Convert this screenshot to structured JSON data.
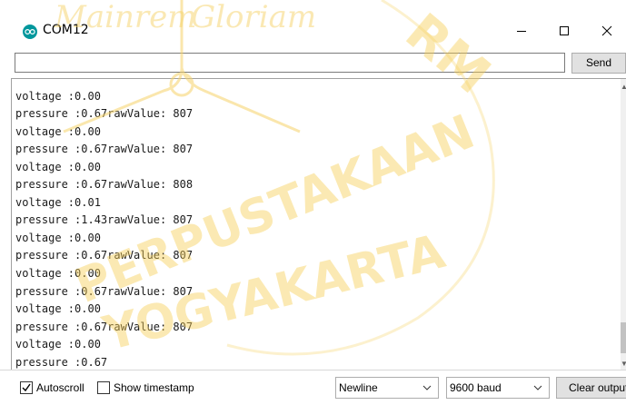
{
  "window": {
    "title": "COM12",
    "icon": "arduino-icon",
    "controls": [
      "minimize-icon",
      "maximize-icon",
      "close-icon"
    ]
  },
  "send_row": {
    "input_value": "",
    "send_label": "Send"
  },
  "output": {
    "lines": [
      "voltage :0.00",
      "pressure :0.67rawValue: 807",
      "voltage :0.00",
      "pressure :0.67rawValue: 807",
      "voltage :0.00",
      "pressure :0.67rawValue: 808",
      "voltage :0.01",
      "pressure :1.43rawValue: 807",
      "voltage :0.00",
      "pressure :0.67rawValue: 807",
      "voltage :0.00",
      "pressure :0.67rawValue: 807",
      "voltage :0.00",
      "pressure :0.67rawValue: 807",
      "voltage :0.00",
      "pressure :0.67"
    ]
  },
  "bottom_bar": {
    "autoscroll_label": "Autoscroll",
    "autoscroll_checked": true,
    "timestamp_label": "Show timestamp",
    "timestamp_checked": false,
    "line_ending": "Newline",
    "baud_rate": "9600 baud",
    "clear_label": "Clear output"
  },
  "watermark": {
    "text_top": "Mainrem Gloriam",
    "text_middle": "PERPUSTAKAAN",
    "text_bottom": "YOGYAKARTA",
    "text_right": "RM",
    "color": "#f5cf55"
  }
}
